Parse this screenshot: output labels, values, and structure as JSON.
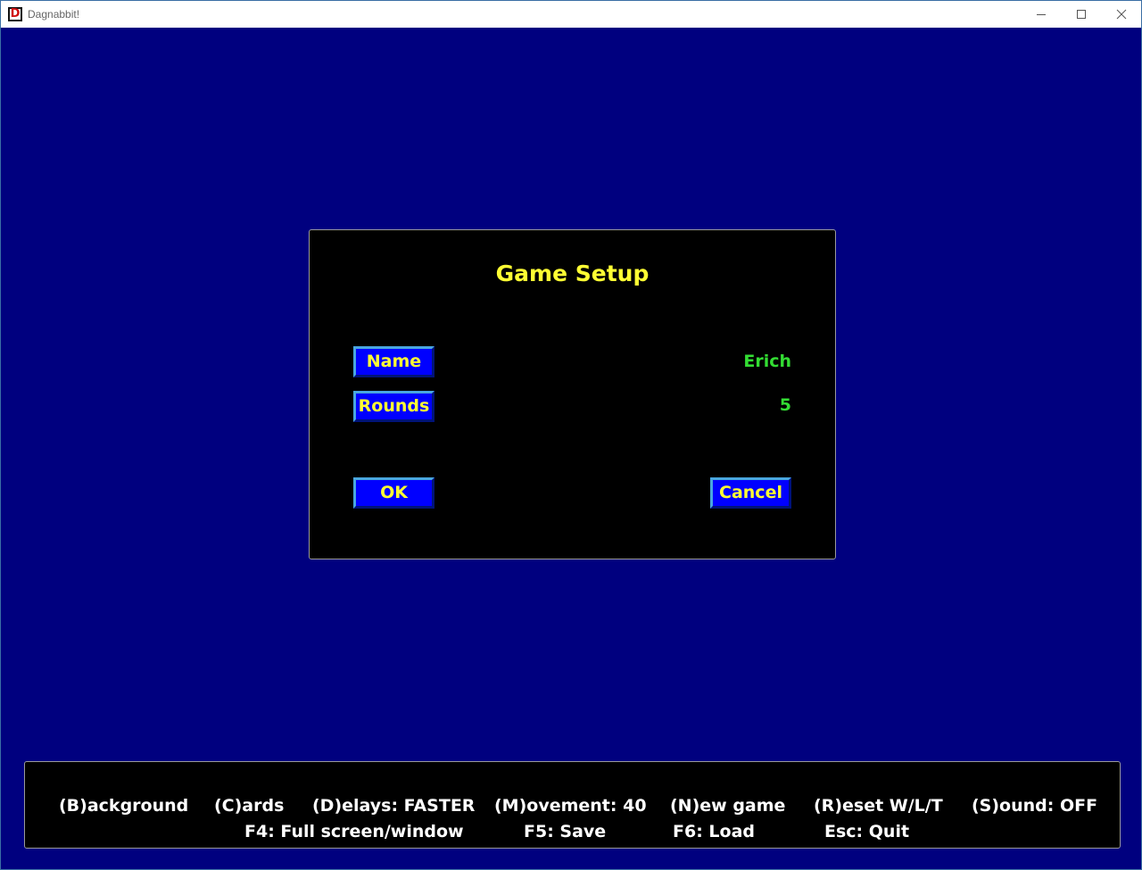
{
  "window": {
    "title": "Dagnabbit!",
    "icon": "app-icon-D",
    "icon_letter": "D",
    "controls": [
      "minimize-icon",
      "maximize-icon",
      "close-icon"
    ]
  },
  "colors": {
    "background": "#00007f",
    "dialog_bg": "#000000",
    "title_text": "#ffff33",
    "value_text": "#33dd33",
    "button_face": "#0000ff",
    "key_text": "#ffffff"
  },
  "dialog": {
    "title": "Game Setup",
    "name_button": "Name",
    "name_value": "Erich",
    "rounds_button": "Rounds",
    "rounds_value": "5",
    "ok_button": "OK",
    "cancel_button": "Cancel"
  },
  "shortcuts": {
    "background": "(B)ackground",
    "cards": "(C)ards",
    "delays": "(D)elays: FASTER",
    "movement": "(M)ovement: 40",
    "new_game": "(N)ew game",
    "reset": "(R)eset W/L/T",
    "sound": "(S)ound: OFF",
    "fullscreen": "F4: Full screen/window",
    "save": "F5: Save",
    "load": "F6: Load",
    "quit": "Esc: Quit"
  }
}
